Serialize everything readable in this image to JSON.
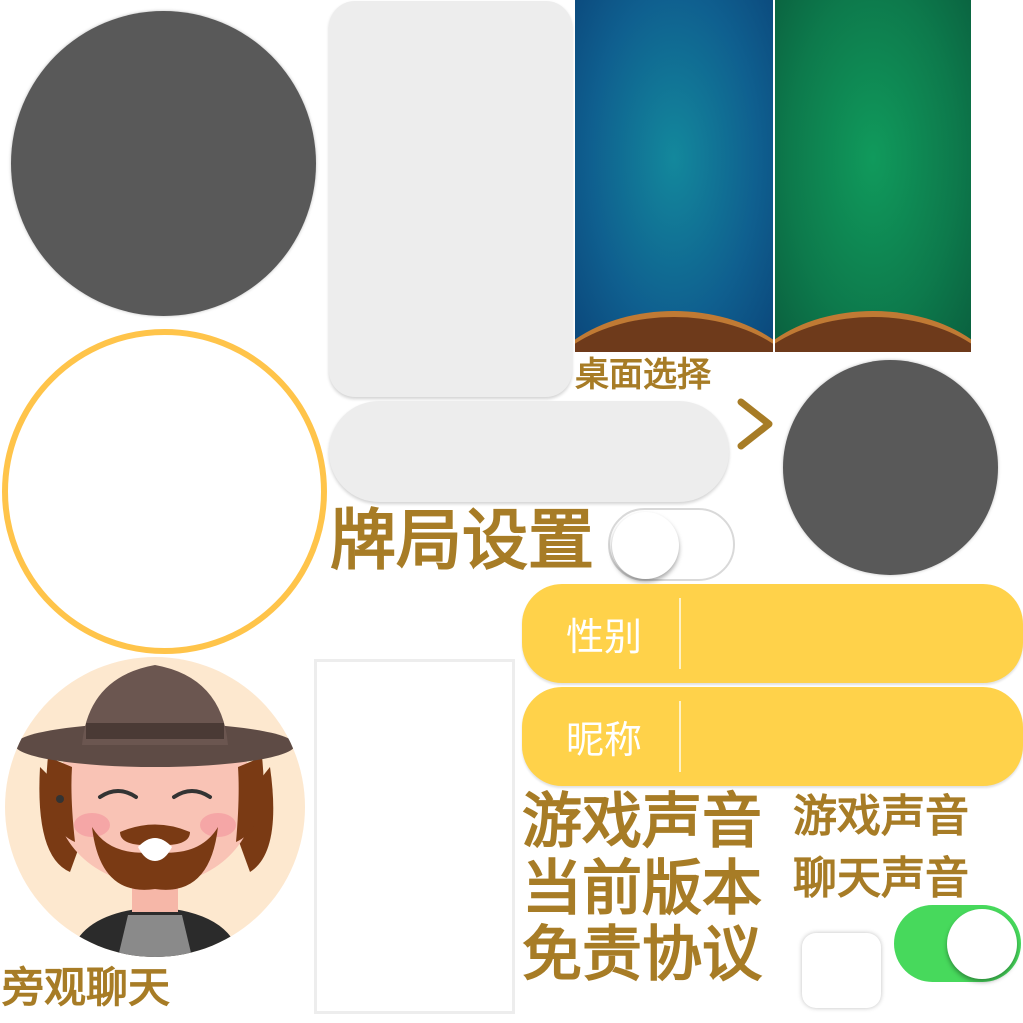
{
  "labels": {
    "table_select": "桌面选择",
    "game_settings": "牌局设置",
    "gender": "性别",
    "nickname": "昵称",
    "game_sound": "游戏声音",
    "game_sound_small": "游戏声音",
    "current_version": "当前版本",
    "chat_sound": "聊天声音",
    "agreement": "免责协议",
    "spectator_chat": "旁观聊天"
  },
  "icons": {
    "arrow": "chevron-right-icon",
    "avatar": "bearded-man-avatar"
  },
  "colors": {
    "gold": "#a77c26",
    "yellow": "#ffd24a",
    "ring": "#ffc44a",
    "toggle_on": "#47d95c",
    "table_blue": "#117a96",
    "table_green": "#0f8a55",
    "grey": "#595959"
  },
  "toggles": {
    "settings_toggle_on": false,
    "chat_sound_toggle_on": true
  }
}
